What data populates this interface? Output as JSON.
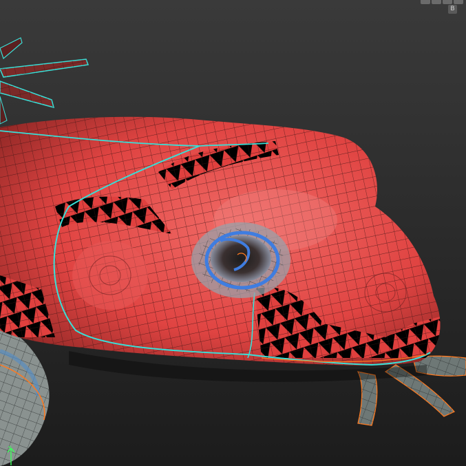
{
  "viewport": {
    "shortcut_label": "B"
  },
  "colors": {
    "background_top": "#383838",
    "background_bottom": "#1e1e1e",
    "mesh_red": "#e84a48",
    "mesh_red_dark": "#b8302e",
    "mesh_grey": "#7e8886",
    "wire": "#3a1a1a",
    "seam_cyan": "#38e0d8",
    "seam_orange": "#ff7a20",
    "eye_blue": "#3f7de0",
    "gizmo_green": "#3cff5a"
  },
  "icons": [
    "viewport-corner-button",
    "axis-gizmo-icon"
  ]
}
